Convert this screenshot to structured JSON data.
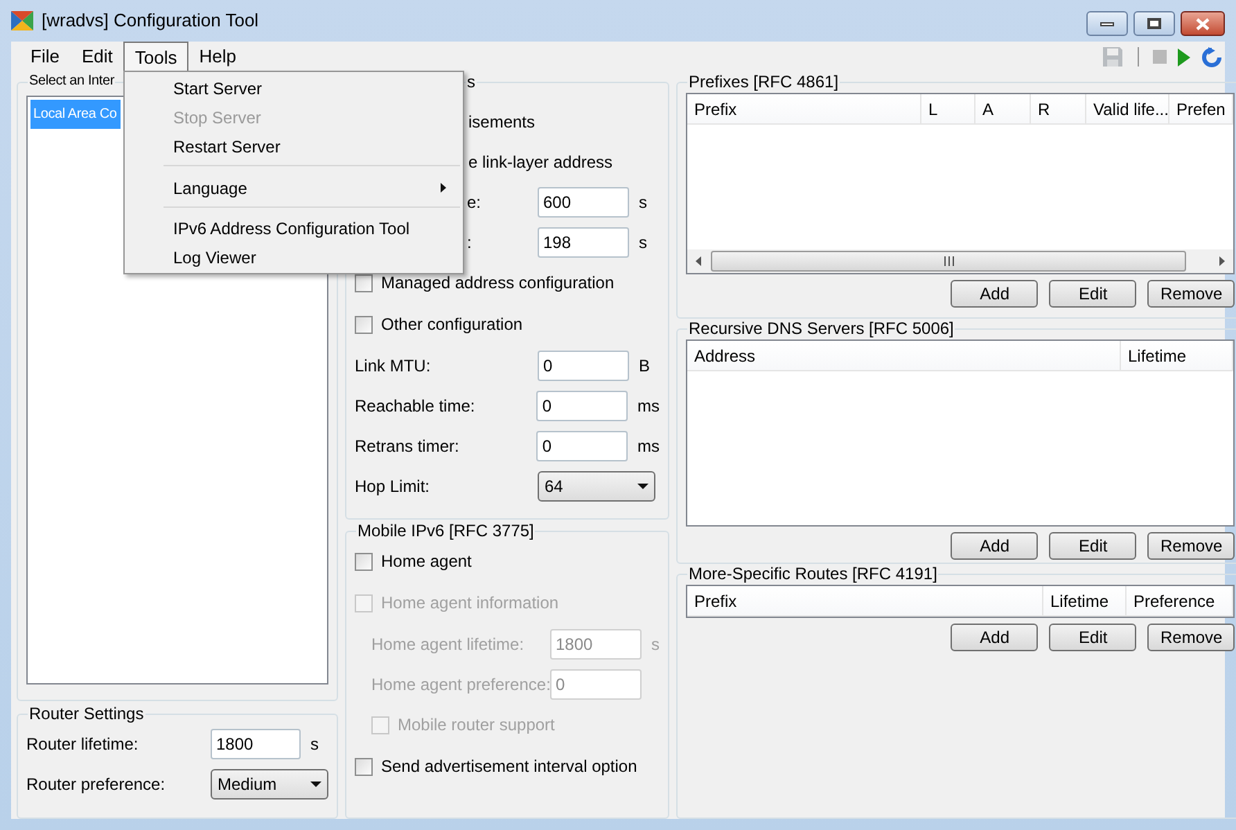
{
  "window": {
    "title": "[wradvs] Configuration Tool"
  },
  "menu_bar": [
    {
      "label": "File",
      "selected": false
    },
    {
      "label": "Edit",
      "selected": false
    },
    {
      "label": "Tools",
      "selected": true
    },
    {
      "label": "Help",
      "selected": false
    }
  ],
  "toolbar": [
    {
      "kind": "save",
      "disabled": true
    },
    {
      "kind": "stop",
      "disabled": true
    },
    {
      "kind": "start",
      "disabled": false
    },
    {
      "kind": "restart",
      "disabled": false
    }
  ],
  "tools_menu": {
    "items": [
      {
        "kind": "item",
        "label": "Start Server",
        "disabled": false
      },
      {
        "kind": "item",
        "label": "Stop Server",
        "disabled": true
      },
      {
        "kind": "item",
        "label": "Restart Server",
        "disabled": false
      },
      {
        "kind": "separator"
      },
      {
        "kind": "submenu",
        "label": "Language",
        "disabled": false
      },
      {
        "kind": "separator"
      },
      {
        "kind": "item",
        "label": "IPv6 Address Configuration Tool",
        "disabled": false
      },
      {
        "kind": "item",
        "label": "Log Viewer",
        "disabled": false
      }
    ]
  },
  "interface_group": {
    "title": "Select an Inter",
    "items": [
      {
        "label": "Local Area Co",
        "selected": true
      }
    ]
  },
  "router_settings": {
    "title": "Router Settings",
    "rows": [
      {
        "kind": "field",
        "label": "Router lifetime:",
        "value": "1800",
        "unit": "s"
      },
      {
        "kind": "select",
        "label": "Router preference:",
        "value": "Medium"
      }
    ]
  },
  "interface_settings": {
    "title": "s",
    "rows": [
      {
        "kind": "fragment",
        "label": "isements"
      },
      {
        "kind": "fragment",
        "label": "e link-layer address"
      },
      {
        "kind": "field_fragment",
        "label": "e:",
        "value": "600",
        "unit": "s"
      },
      {
        "kind": "field_fragment",
        "label": ":",
        "value": "198",
        "unit": "s"
      },
      {
        "kind": "checkbox",
        "label": "Managed address configuration",
        "checked": false,
        "disabled": false
      },
      {
        "kind": "checkbox",
        "label": "Other configuration",
        "checked": false,
        "disabled": false
      },
      {
        "kind": "field",
        "label": "Link MTU:",
        "value": "0",
        "unit": "B"
      },
      {
        "kind": "field",
        "label": "Reachable time:",
        "value": "0",
        "unit": "ms"
      },
      {
        "kind": "field",
        "label": "Retrans timer:",
        "value": "0",
        "unit": "ms"
      },
      {
        "kind": "select",
        "label": "Hop Limit:",
        "value": "64"
      }
    ]
  },
  "mobile_ipv6": {
    "title": "Mobile IPv6 [RFC 3775]",
    "rows": [
      {
        "kind": "checkbox",
        "label": "Home agent",
        "checked": false,
        "disabled": false
      },
      {
        "kind": "checkbox",
        "label": "Home agent information",
        "checked": false,
        "disabled": true,
        "children": [
          {
            "kind": "field",
            "label": "Home agent lifetime:",
            "value": "1800",
            "unit": "s",
            "disabled": true
          },
          {
            "kind": "field",
            "label": "Home agent preference:",
            "value": "0",
            "disabled": true
          },
          {
            "kind": "checkbox",
            "label": "Mobile router support",
            "checked": false,
            "disabled": true
          }
        ]
      },
      {
        "kind": "checkbox",
        "label": "Send advertisement interval option",
        "checked": false,
        "disabled": false
      }
    ]
  },
  "prefixes": {
    "title": "Prefixes [RFC 4861]",
    "columns": [
      "Prefix",
      "L",
      "A",
      "R",
      "Valid life...",
      "Prefen"
    ],
    "buttons": [
      "Add",
      "Edit",
      "Remove"
    ]
  },
  "dns_servers": {
    "title": "Recursive DNS Servers [RFC 5006]",
    "columns": [
      "Address",
      "Lifetime"
    ],
    "buttons": [
      "Add",
      "Edit",
      "Remove"
    ]
  },
  "routes": {
    "title": "More-Specific Routes [RFC 4191]",
    "columns": [
      "Prefix",
      "Lifetime",
      "Preference"
    ],
    "buttons": [
      "Add",
      "Edit",
      "Remove"
    ]
  }
}
